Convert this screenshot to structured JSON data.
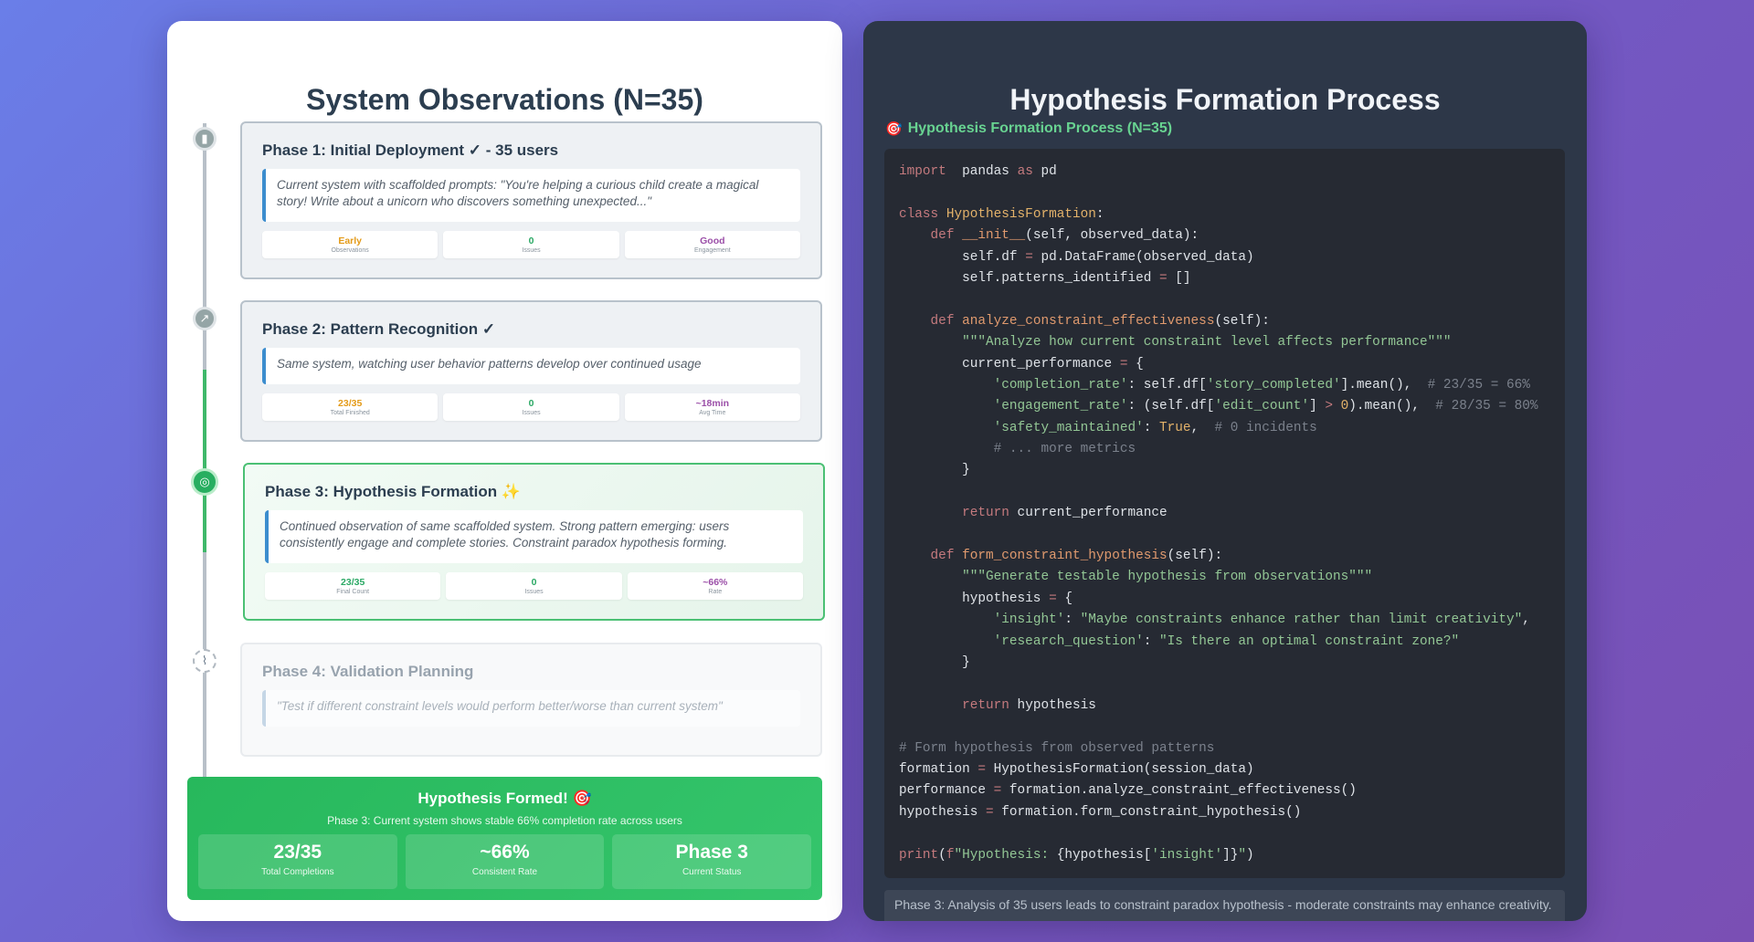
{
  "left": {
    "title": "System Observations (N=35)",
    "phases": [
      {
        "icon": "chart-bar-icon",
        "title": "Phase 1: Initial Deployment ✓ - 35 users",
        "note": "Current system with scaffolded prompts: \"You're helping a curious child create a magical story! Write about a unicorn who discovers something unexpected...\"",
        "stats": [
          {
            "value": "Early",
            "label": "Observations",
            "color": "#e39a18"
          },
          {
            "value": "0",
            "label": "Issues",
            "color": "#2aa864"
          },
          {
            "value": "Good",
            "label": "Engagement",
            "color": "#9b4fa8"
          }
        ]
      },
      {
        "icon": "chart-line-icon",
        "title": "Phase 2: Pattern Recognition ✓",
        "note": "Same system, watching user behavior patterns develop over continued usage",
        "stats": [
          {
            "value": "23/35",
            "label": "Total Finished",
            "color": "#e39a18"
          },
          {
            "value": "0",
            "label": "Issues",
            "color": "#2aa864"
          },
          {
            "value": "~18min",
            "label": "Avg Time",
            "color": "#9b4fa8"
          }
        ]
      },
      {
        "icon": "target-icon",
        "title": "Phase 3: Hypothesis Formation ✨",
        "note": "Continued observation of same scaffolded system. Strong pattern emerging: users consistently engage and complete stories. Constraint paradox hypothesis forming.",
        "stats": [
          {
            "value": "23/35",
            "label": "Final Count",
            "color": "#2aa864"
          },
          {
            "value": "0",
            "label": "Issues",
            "color": "#2aa864"
          },
          {
            "value": "~66%",
            "label": "Rate",
            "color": "#9b4fa8"
          }
        ]
      },
      {
        "icon": "test-tube-icon",
        "title": "Phase 4: Validation Planning",
        "note": "\"Test if different constraint levels would perform better/worse than current system\""
      }
    ],
    "summary": {
      "title": "Hypothesis Formed! 🎯",
      "subtitle": "Phase 3: Current system shows stable 66% completion rate across users",
      "boxes": [
        {
          "value": "23/35",
          "label": "Total Completions"
        },
        {
          "value": "~66%",
          "label": "Consistent Rate"
        },
        {
          "value": "Phase 3",
          "label": "Current Status"
        }
      ]
    }
  },
  "right": {
    "title": "Hypothesis Formation Process",
    "code_label": "Hypothesis Formation Process (N=35)",
    "code_lines": [
      [
        [
          "kw",
          "import"
        ],
        [
          "",
          "  pandas "
        ],
        [
          "kw",
          "as"
        ],
        [
          "",
          " pd"
        ]
      ],
      [],
      [
        [
          "kw",
          "class"
        ],
        [
          "",
          " "
        ],
        [
          "cls",
          "HypothesisFormation"
        ],
        [
          "",
          ":"
        ]
      ],
      [
        [
          "",
          "    "
        ],
        [
          "kw",
          "def"
        ],
        [
          "",
          " "
        ],
        [
          "fn",
          "__init__"
        ],
        [
          "",
          "(self, observed_data):"
        ]
      ],
      [
        [
          "",
          "        self.df "
        ],
        [
          "op",
          "="
        ],
        [
          "",
          " pd.DataFrame(observed_data)"
        ]
      ],
      [
        [
          "",
          "        self.patterns_identified "
        ],
        [
          "op",
          "="
        ],
        [
          "",
          " []"
        ]
      ],
      [],
      [
        [
          "",
          "    "
        ],
        [
          "kw",
          "def"
        ],
        [
          "",
          " "
        ],
        [
          "fn",
          "analyze_constraint_effectiveness"
        ],
        [
          "",
          "(self):"
        ]
      ],
      [
        [
          "",
          "        "
        ],
        [
          "str",
          "\"\"\"Analyze how current constraint level affects performance\"\"\""
        ]
      ],
      [
        [
          "",
          "        current_performance "
        ],
        [
          "op",
          "="
        ],
        [
          "",
          " {"
        ]
      ],
      [
        [
          "",
          "            "
        ],
        [
          "str",
          "'completion_rate'"
        ],
        [
          "",
          ": self.df["
        ],
        [
          "str",
          "'story_completed'"
        ],
        [
          "",
          "].mean(),  "
        ],
        [
          "com",
          "# 23/35 = 66%"
        ]
      ],
      [
        [
          "",
          "            "
        ],
        [
          "str",
          "'engagement_rate'"
        ],
        [
          "",
          ": (self.df["
        ],
        [
          "str",
          "'edit_count'"
        ],
        [
          "",
          "] "
        ],
        [
          "op",
          ">"
        ],
        [
          "",
          " "
        ],
        [
          "num",
          "0"
        ],
        [
          "",
          ").mean(),  "
        ],
        [
          "com",
          "# 28/35 = 80%"
        ]
      ],
      [
        [
          "",
          "            "
        ],
        [
          "str",
          "'safety_maintained'"
        ],
        [
          "",
          ": "
        ],
        [
          "num",
          "True"
        ],
        [
          "",
          ",  "
        ],
        [
          "com",
          "# 0 incidents"
        ]
      ],
      [
        [
          "",
          "            "
        ],
        [
          "com",
          "# ... more metrics"
        ]
      ],
      [
        [
          "",
          "        }"
        ]
      ],
      [],
      [
        [
          "",
          "        "
        ],
        [
          "kw",
          "return"
        ],
        [
          "",
          " current_performance"
        ]
      ],
      [],
      [
        [
          "",
          "    "
        ],
        [
          "kw",
          "def"
        ],
        [
          "",
          " "
        ],
        [
          "fn",
          "form_constraint_hypothesis"
        ],
        [
          "",
          "(self):"
        ]
      ],
      [
        [
          "",
          "        "
        ],
        [
          "str",
          "\"\"\"Generate testable hypothesis from observations\"\"\""
        ]
      ],
      [
        [
          "",
          "        hypothesis "
        ],
        [
          "op",
          "="
        ],
        [
          "",
          " {"
        ]
      ],
      [
        [
          "",
          "            "
        ],
        [
          "str",
          "'insight'"
        ],
        [
          "",
          ": "
        ],
        [
          "str",
          "\"Maybe constraints enhance rather than limit creativity\""
        ],
        [
          "",
          ","
        ]
      ],
      [
        [
          "",
          "            "
        ],
        [
          "str",
          "'research_question'"
        ],
        [
          "",
          ": "
        ],
        [
          "str",
          "\"Is there an optimal constraint zone?\""
        ]
      ],
      [
        [
          "",
          "        }"
        ]
      ],
      [],
      [
        [
          "",
          "        "
        ],
        [
          "kw",
          "return"
        ],
        [
          "",
          " hypothesis"
        ]
      ],
      [],
      [
        [
          "com",
          "# Form hypothesis from observed patterns"
        ]
      ],
      [
        [
          "",
          "formation "
        ],
        [
          "op",
          "="
        ],
        [
          "",
          " HypothesisFormation(session_data)"
        ]
      ],
      [
        [
          "",
          "performance "
        ],
        [
          "op",
          "="
        ],
        [
          "",
          " formation.analyze_constraint_effectiveness()"
        ]
      ],
      [
        [
          "",
          "hypothesis "
        ],
        [
          "op",
          "="
        ],
        [
          "",
          " formation.form_constraint_hypothesis()"
        ]
      ],
      [],
      [
        [
          "kw",
          "print"
        ],
        [
          "",
          "("
        ],
        [
          "kw",
          "f"
        ],
        [
          "str",
          "\"Hypothesis: "
        ],
        [
          "",
          "{hypothesis["
        ],
        [
          "str",
          "'insight'"
        ],
        [
          "",
          "]}"
        ],
        [
          "str",
          "\""
        ],
        [
          "",
          ")"
        ]
      ]
    ],
    "caption": "Phase 3: Analysis of 35 users leads to constraint paradox hypothesis - moderate constraints may enhance creativity."
  }
}
